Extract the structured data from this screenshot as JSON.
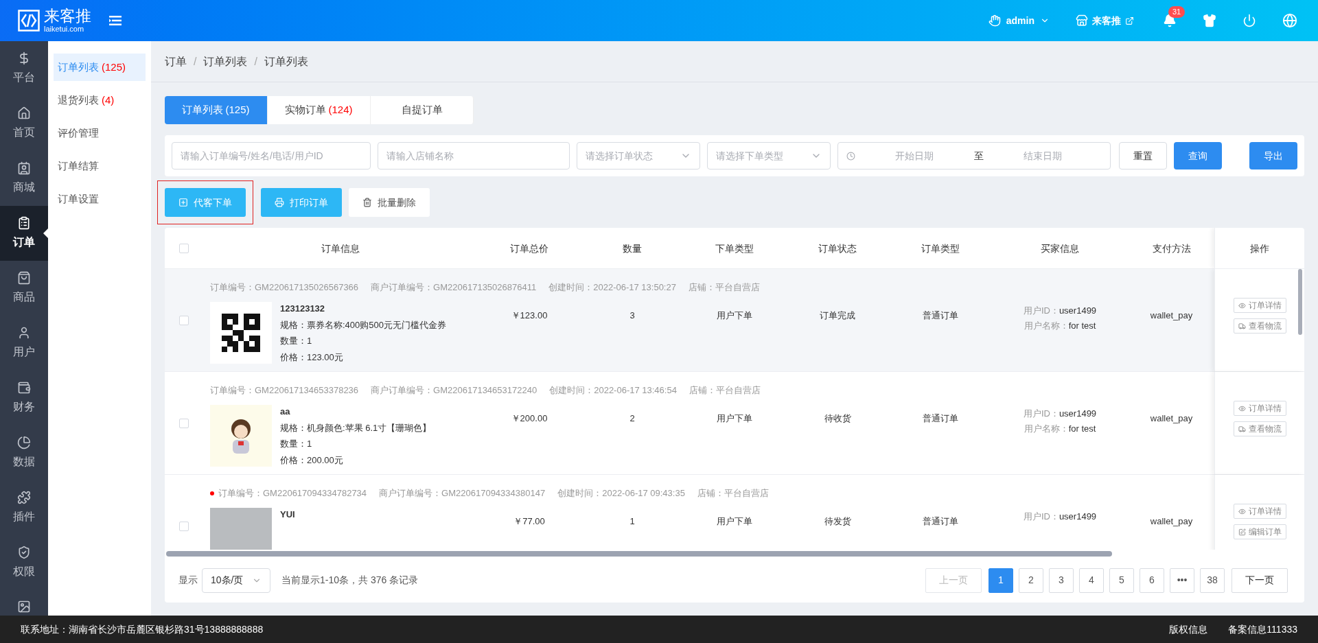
{
  "header": {
    "logo_name": "来客推",
    "logo_domain": "laiketui.com",
    "user": "admin",
    "store": "来客推",
    "notifications": "31"
  },
  "nav": [
    {
      "label": "平台",
      "selected": false
    },
    {
      "label": "首页",
      "selected": false
    },
    {
      "label": "商城",
      "selected": false
    },
    {
      "label": "订单",
      "selected": true
    },
    {
      "label": "商品",
      "selected": false
    },
    {
      "label": "用户",
      "selected": false
    },
    {
      "label": "财务",
      "selected": false
    },
    {
      "label": "数据",
      "selected": false
    },
    {
      "label": "插件",
      "selected": false
    },
    {
      "label": "权限",
      "selected": false
    }
  ],
  "subnav": [
    {
      "label": "订单列表",
      "count": "(125)",
      "selected": true
    },
    {
      "label": "退货列表",
      "count": "(4)",
      "selected": false
    },
    {
      "label": "评价管理",
      "selected": false
    },
    {
      "label": "订单结算",
      "selected": false
    },
    {
      "label": "订单设置",
      "selected": false
    }
  ],
  "breadcrumb": {
    "items": [
      "订单",
      "订单列表",
      "订单列表"
    ],
    "separator": "/"
  },
  "tabs": [
    {
      "label": "订单列表",
      "count": "(125)",
      "selected": true
    },
    {
      "label": "实物订单",
      "count": "(124)",
      "selected": false
    },
    {
      "label": "自提订单",
      "selected": false
    }
  ],
  "filters": {
    "order_search": {
      "placeholder": "请输入订单编号/姓名/电话/用户ID"
    },
    "store": {
      "placeholder": "请输入店铺名称"
    },
    "status": {
      "placeholder": "请选择订单状态"
    },
    "order_type": {
      "placeholder": "请选择下单类型"
    },
    "start_date": {
      "placeholder": "开始日期"
    },
    "date_separator": "至",
    "end_date": {
      "placeholder": "结束日期"
    },
    "reset": "重置",
    "query": "查询",
    "export": "导出"
  },
  "actions": [
    {
      "label": "代客下单",
      "kind": "add",
      "highlighted": true
    },
    {
      "label": "打印订单",
      "kind": "print",
      "highlighted": false
    },
    {
      "label": "批量删除",
      "kind": "delete",
      "highlighted": false
    }
  ],
  "table": {
    "select_all_checked": false,
    "columns": [
      "订单信息",
      "订单总价",
      "数量",
      "下单类型",
      "订单状态",
      "订单类型",
      "买家信息",
      "支付方法",
      "操作"
    ],
    "rows": [
      {
        "highlighted": true,
        "checked": false,
        "flagged": false,
        "meta": [
          "订单编号：GM220617135026567366",
          "商户订单编号：GM220617135026876411",
          "创建时间：2022-06-17 13:50:27",
          "店铺：平台自营店"
        ],
        "product": {
          "kind": "qr",
          "name": "123123132",
          "lines": [
            "规格：票券名称:400购500元无门槛代金券",
            "数量：1",
            "价格：123.00元"
          ]
        },
        "total": "￥123.00",
        "qty": "3",
        "order_type": "用户下单",
        "status": "订单完成",
        "category": "普通订单",
        "buyer": [
          {
            "label": "用户ID：",
            "value": "user1499"
          },
          {
            "label": "用户名称：",
            "value": "for test"
          }
        ],
        "payment": "wallet_pay",
        "ops": [
          {
            "label": "订单详情",
            "kind": "detail"
          },
          {
            "label": "查看物流",
            "kind": "logistics"
          }
        ]
      },
      {
        "highlighted": false,
        "checked": false,
        "flagged": false,
        "meta": [
          "订单编号：GM220617134653378236",
          "商户订单编号：GM220617134653172240",
          "创建时间：2022-06-17 13:46:54",
          "店铺：平台自营店"
        ],
        "product": {
          "kind": "illustration",
          "name": "aa",
          "lines": [
            "规格：机身颜色:苹果 6.1寸【珊瑚色】",
            "数量：1",
            "价格：200.00元"
          ]
        },
        "total": "￥200.00",
        "qty": "2",
        "order_type": "用户下单",
        "status": "待收货",
        "category": "普通订单",
        "buyer": [
          {
            "label": "用户ID：",
            "value": "user1499"
          },
          {
            "label": "用户名称：",
            "value": "for test"
          }
        ],
        "payment": "wallet_pay",
        "ops": [
          {
            "label": "订单详情",
            "kind": "detail"
          },
          {
            "label": "查看物流",
            "kind": "logistics"
          }
        ]
      },
      {
        "highlighted": false,
        "checked": false,
        "flagged": true,
        "meta": [
          "订单编号：GM220617094334782734",
          "商户订单编号：GM220617094334380147",
          "创建时间：2022-06-17 09:43:35",
          "店铺：平台自营店"
        ],
        "product": {
          "kind": "photo",
          "name": "YUI"
        },
        "total": "￥77.00",
        "qty": "1",
        "order_type": "用户下单",
        "status": "待发货",
        "category": "普通订单",
        "buyer": [
          {
            "label": "用户ID：",
            "value": "user1499"
          }
        ],
        "payment": "wallet_pay",
        "ops": [
          {
            "label": "订单详情",
            "kind": "detail"
          },
          {
            "label": "编辑订单",
            "kind": "edit"
          }
        ]
      }
    ]
  },
  "pagination": {
    "show_label": "显示",
    "page_size": "10条/页",
    "summary": "当前显示1-10条，共 376 条记录",
    "prev": "上一页",
    "pages": [
      {
        "label": "1",
        "selected": true
      },
      {
        "label": "2",
        "selected": false
      },
      {
        "label": "3",
        "selected": false
      },
      {
        "label": "4",
        "selected": false
      },
      {
        "label": "5",
        "selected": false
      },
      {
        "label": "6",
        "selected": false
      },
      {
        "label": "•••",
        "selected": false
      },
      {
        "label": "38",
        "selected": false
      }
    ],
    "next": "下一页"
  },
  "footer": {
    "address": "联系地址：湖南省长沙市岳麓区银杉路31号13888888888",
    "copyright": "版权信息",
    "record": "备案信息111333"
  }
}
